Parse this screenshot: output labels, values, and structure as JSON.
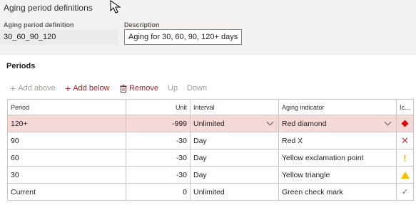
{
  "page": {
    "title": "Aging period definitions"
  },
  "form": {
    "definition_label": "Aging period definition",
    "definition_value": "30_60_90_120",
    "description_label": "Description",
    "description_value": "Aging for 30, 60, 90, 120+ days"
  },
  "periods": {
    "title": "Periods",
    "toolbar": {
      "add_above": "Add above",
      "add_below": "Add below",
      "remove": "Remove",
      "up": "Up",
      "down": "Down"
    },
    "columns": {
      "period": "Period",
      "unit": "Unit",
      "interval": "Interval",
      "aging_indicator": "Aging indicator",
      "icon": "Ic..."
    },
    "rows": [
      {
        "period": "120+",
        "unit": "-999",
        "interval": "Unlimited",
        "indicator": "Red diamond",
        "icon": "red-diamond-icon"
      },
      {
        "period": "90",
        "unit": "-30",
        "interval": "Day",
        "indicator": "Red X",
        "icon": "red-x-icon"
      },
      {
        "period": "60",
        "unit": "-30",
        "interval": "Day",
        "indicator": "Yellow exclamation point",
        "icon": "yellow-exclamation-icon"
      },
      {
        "period": "30",
        "unit": "-30",
        "interval": "Day",
        "indicator": "Yellow triangle",
        "icon": "yellow-triangle-icon"
      },
      {
        "period": "Current",
        "unit": "0",
        "interval": "Unlimited",
        "indicator": "Green check mark",
        "icon": "check-mark-icon"
      }
    ]
  },
  "colors": {
    "selected_row": "#f4d9d6",
    "accent_red": "#a4262c",
    "diamond_red": "#e00000",
    "yellow": "#f2c200"
  }
}
